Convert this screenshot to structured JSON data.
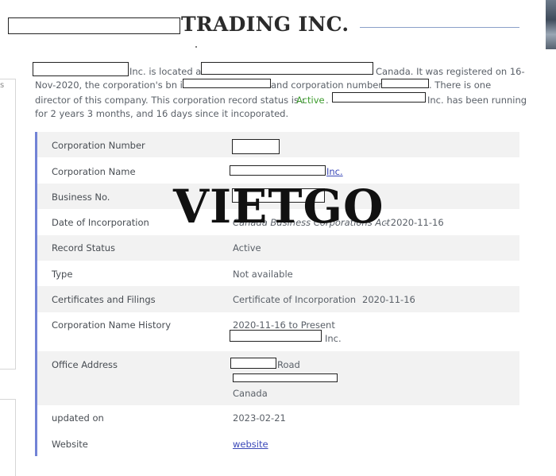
{
  "header": {
    "title": "TRADING INC."
  },
  "summary": {
    "line1_a": "Inc. is located at",
    "line1_b": "Canada. It was registered on 16-",
    "line2_a": "Nov-2020, the corporation's bn is",
    "line2_b": "and corporation number",
    "line2_c": ". There is one",
    "line3_a": "director of this company. This corporation record status is :",
    "line3_status": "Active",
    "line3_b": ".",
    "line3_c": "Inc. has been running",
    "line4": "for 2 years 3 months, and 16 days since it incoporated."
  },
  "details": {
    "corporation_number": {
      "label": "Corporation Number"
    },
    "corporation_name": {
      "label": "Corporation Name",
      "value_suffix": "Inc."
    },
    "business_no": {
      "label": "Business No."
    },
    "date_of_incorporation": {
      "label": "Date of Incorporation",
      "act": "Canada Business Corporations Act",
      "date": " - 2020-11-16"
    },
    "record_status": {
      "label": "Record Status",
      "value": "Active"
    },
    "type": {
      "label": "Type",
      "value": "Not available"
    },
    "certificates": {
      "label": "Certificates and Filings",
      "value": "Certificate of Incorporation",
      "date": "2020-11-16"
    },
    "name_history": {
      "label": "Corporation Name History",
      "period": "2020-11-16 to Present",
      "name_suffix": "Inc."
    },
    "office_address": {
      "label": "Office Address",
      "street_suffix": "Road",
      "country": "Canada"
    },
    "updated_on": {
      "label": "updated on",
      "value": "2023-02-21"
    },
    "website": {
      "label": "Website",
      "value": "website"
    }
  },
  "watermark": {
    "text": "VIETGO"
  },
  "colors": {
    "accent_bar": "#7283d6",
    "link": "#3a48b8",
    "status_green": "#3a9a2a",
    "row_alt": "#f2f2f2"
  }
}
